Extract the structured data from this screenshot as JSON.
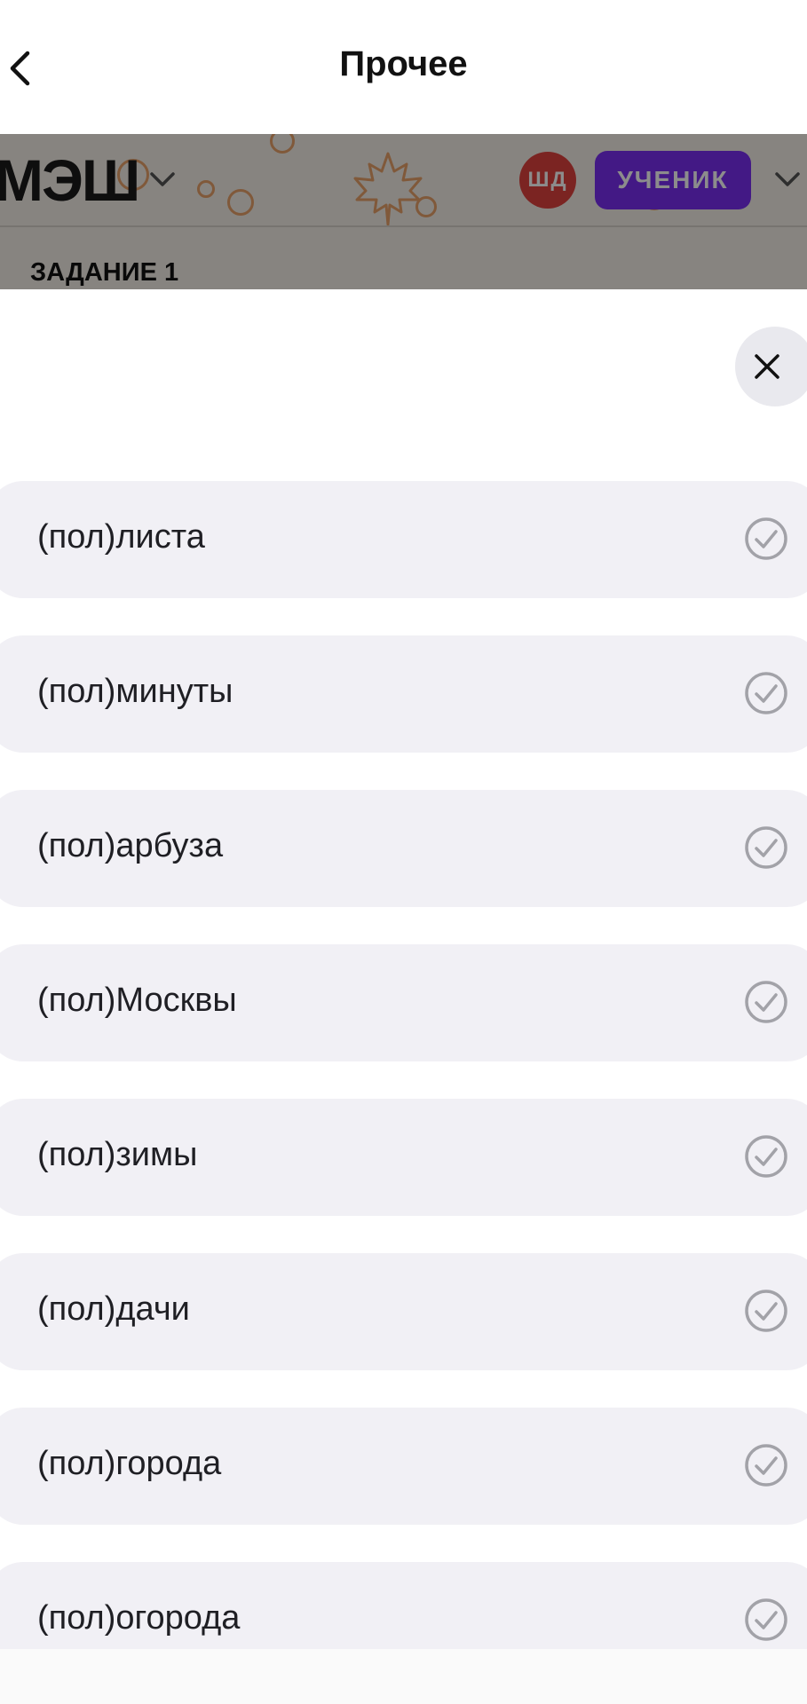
{
  "nav": {
    "title": "Прочее",
    "back_icon": "chevron-left-icon"
  },
  "webview": {
    "logo": "МЭШ",
    "avatar_initials": "ШД",
    "role": "УЧЕНИК",
    "task_title": "ЗАДАНИЕ 1",
    "colors": {
      "avatar": "#e0433f",
      "role_badge": "#7b2ff2",
      "decor": "#e9a26b"
    }
  },
  "sheet": {
    "close_icon": "close-icon",
    "options": [
      {
        "label": "(пол)листа"
      },
      {
        "label": "(пол)минуты"
      },
      {
        "label": "(пол)арбуза"
      },
      {
        "label": "(пол)Москвы"
      },
      {
        "label": "(пол)зимы"
      },
      {
        "label": "(пол)дачи"
      },
      {
        "label": "(пол)города"
      },
      {
        "label": "(пол)огорода"
      }
    ],
    "option_icon": "check-circle-icon"
  }
}
